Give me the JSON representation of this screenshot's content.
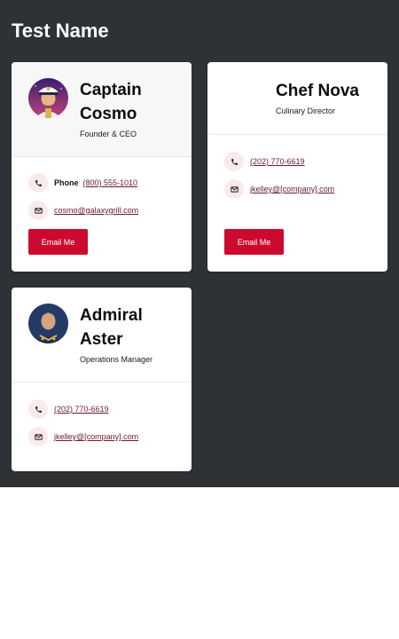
{
  "page": {
    "title": "Test Name"
  },
  "cards": [
    {
      "name_line1": "Captain",
      "name_line2": "Cosmo",
      "role": "Founder & CEO",
      "phone_label": "Phone",
      "phone": "(800) 555-1010",
      "email": "cosmo@galaxygrill.com",
      "button_label": "Email Me"
    },
    {
      "name_line1": "Chef Nova",
      "role": "Culinary Director",
      "phone": "(202) 770-6619",
      "email": "jkelley@[company].com",
      "button_label": "Email Me"
    },
    {
      "name_line1": "Admiral",
      "name_line2": "Aster",
      "role": "Operations Manager",
      "phone": "(202) 770-6619",
      "email": "jkelley@[company].com"
    }
  ],
  "colors": {
    "panel_bg": "#2f3234",
    "accent": "#cc0a2f",
    "icon_bg": "#fbe9ec",
    "link": "#6a1b2a"
  },
  "icons": [
    "phone-icon",
    "envelope-icon",
    "avatar-captain-cosmo",
    "avatar-admiral-aster"
  ]
}
